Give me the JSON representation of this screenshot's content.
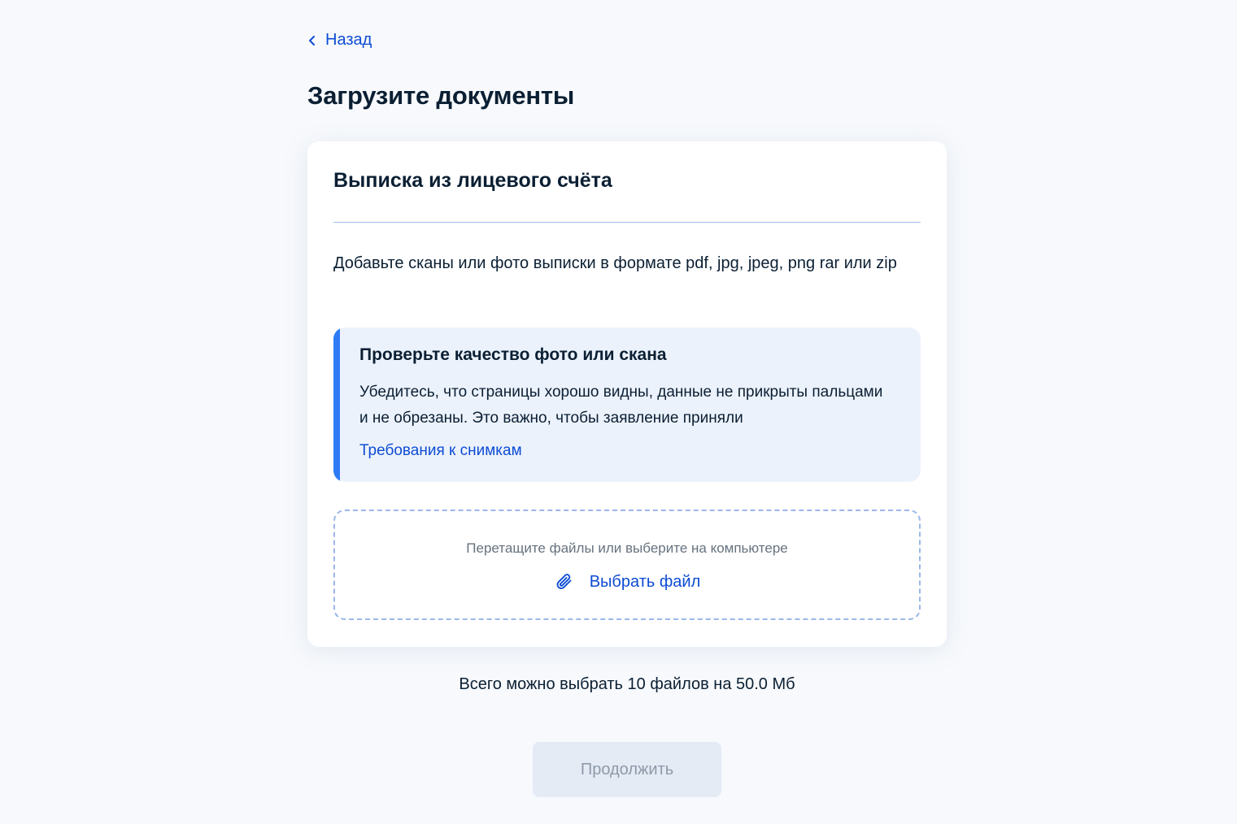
{
  "back": {
    "label": "Назад"
  },
  "page": {
    "title": "Загрузите документы"
  },
  "card": {
    "title": "Выписка из лицевого счёта",
    "description": "Добавьте сканы или фото выписки в формате pdf, jpg, jpeg, png rar или zip",
    "notice": {
      "title": "Проверьте качество фото или скана",
      "text": "Убедитесь, что страницы хорошо видны, данные не прикрыты пальцами и не обрезаны. Это важно, чтобы заявление приняли",
      "link_label": "Требования к снимкам"
    },
    "dropzone": {
      "hint": "Перетащите файлы или выберите на компьютере",
      "choose_label": "Выбрать файл"
    }
  },
  "limits": {
    "text": "Всего можно выбрать 10 файлов на 50.0 Мб"
  },
  "actions": {
    "continue_label": "Продолжить",
    "continue_disabled": true
  },
  "icons": {
    "back": "chevron-left-icon",
    "attach": "paperclip-icon"
  },
  "colors": {
    "link": "#0d4cd3",
    "text": "#0b1f33",
    "notice_accent": "#2d7cf6",
    "notice_bg": "#ecf2fc",
    "background": "#f7f9fc"
  }
}
